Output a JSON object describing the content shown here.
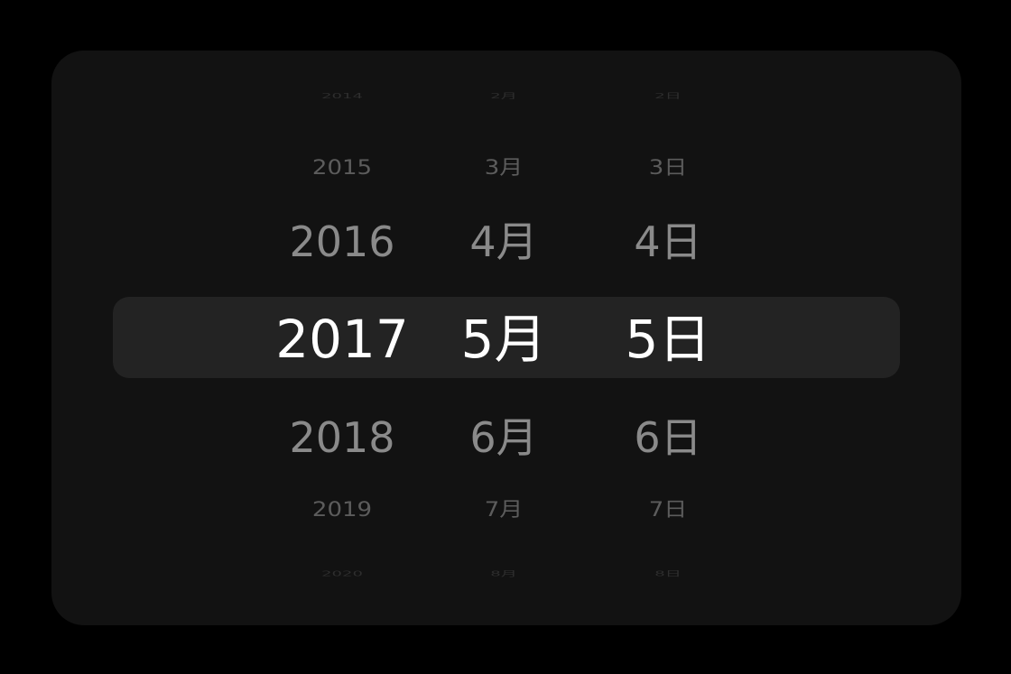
{
  "picker": {
    "selected": {
      "year": "2017",
      "month": "5月",
      "day": "5日"
    },
    "years": [
      "2014",
      "2015",
      "2016",
      "2017",
      "2018",
      "2019",
      "2020"
    ],
    "months": [
      "2月",
      "3月",
      "4月",
      "5月",
      "6月",
      "7月",
      "8月"
    ],
    "days": [
      "2日",
      "3日",
      "4日",
      "5日",
      "6日",
      "7日",
      "8日"
    ]
  },
  "colors": {
    "background": "#000000",
    "card": "#121212",
    "selection_band": "#232323",
    "selected_text": "#ffffff",
    "near_text": "#8a8a8a",
    "far_text": "#5c5c5c",
    "farthest_text": "#2e2e2e"
  }
}
